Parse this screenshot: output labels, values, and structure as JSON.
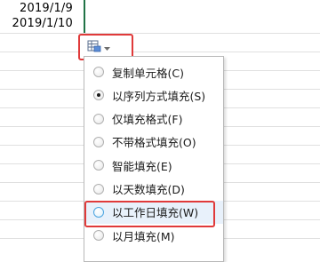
{
  "cells": [
    "2019/1/9",
    "2019/1/10"
  ],
  "fill_options_button": {
    "icon": "fill-options-icon",
    "dropdown_icon": "chevron-down-icon"
  },
  "menu": {
    "items": [
      {
        "label": "复制单元格(C)",
        "checked": false
      },
      {
        "label": "以序列方式填充(S)",
        "checked": true
      },
      {
        "label": "仅填充格式(F)",
        "checked": false
      },
      {
        "label": "不带格式填充(O)",
        "checked": false
      },
      {
        "label": "智能填充(E)",
        "checked": false
      },
      {
        "label": "以天数填充(D)",
        "checked": false
      },
      {
        "label": "以工作日填充(W)",
        "checked": false,
        "hovered": true
      },
      {
        "label": "以月填充(M)",
        "checked": false
      }
    ]
  },
  "colors": {
    "accent_red": "#e03a3a",
    "selection_green": "#217346",
    "hover_blue": "#e8f1fb"
  }
}
